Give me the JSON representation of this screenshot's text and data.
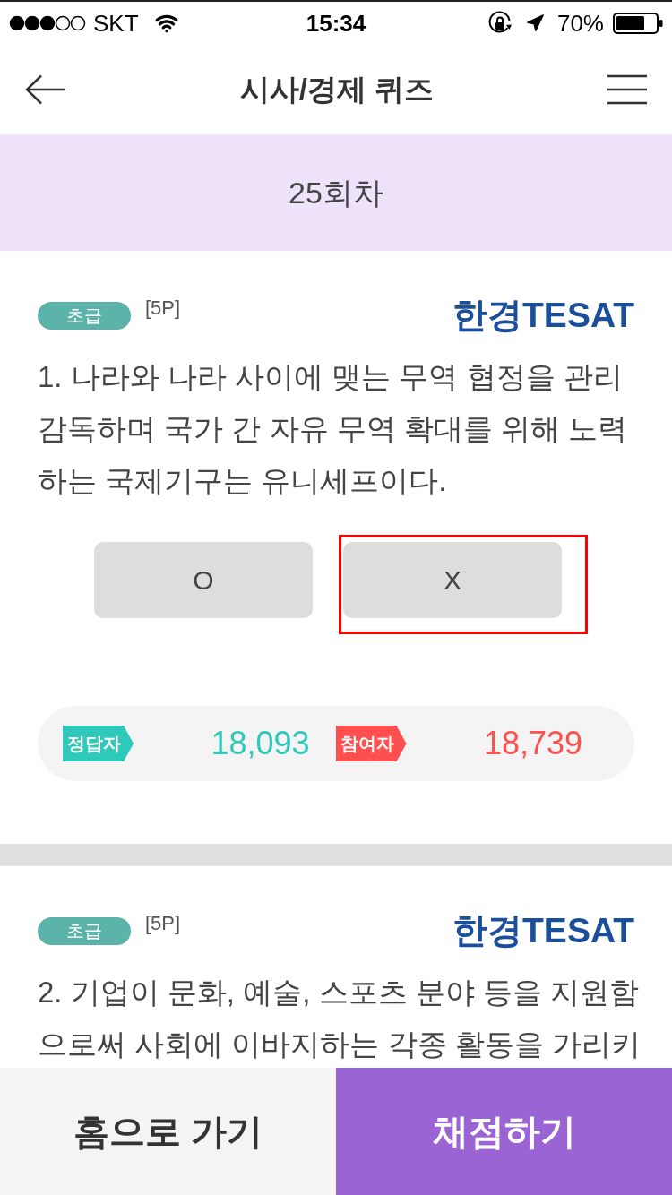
{
  "status_bar": {
    "carrier": "SKT",
    "time": "15:34",
    "battery": "70%"
  },
  "header": {
    "title": "시사/경제 퀴즈"
  },
  "round": {
    "label": "25회차"
  },
  "questions": [
    {
      "grade": "초급",
      "points": "[5P]",
      "logo": "한경TESAT",
      "text": "1. 나라와 나라 사이에 맺는 무역 협정을 관리감독하며 국가 간 자유 무역 확대를 위해 노력하는 국제기구는 유니세프이다.",
      "answers": [
        {
          "label": "O",
          "selected": false
        },
        {
          "label": "X",
          "selected": true
        }
      ],
      "stats": [
        {
          "label": "정답자",
          "count": "18,093",
          "color": "#2ec9b9"
        },
        {
          "label": "참여자",
          "count": "18,739",
          "color": "#ff4f4f"
        }
      ]
    },
    {
      "grade": "초급",
      "points": "[5P]",
      "logo": "한경TESAT",
      "text": "2. 기업이 문화, 예술, 스포츠 분야 등을 지원함으로써 사회에 이바지하는 각종 활동을 가리키"
    }
  ],
  "bottom_bar": {
    "home_button": "홈으로 가기",
    "grade_button": "채점하기"
  }
}
